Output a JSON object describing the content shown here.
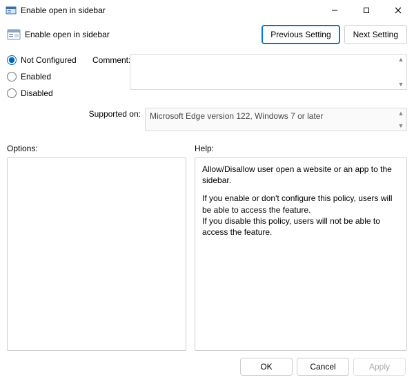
{
  "window": {
    "title": "Enable open in sidebar"
  },
  "header": {
    "title": "Enable open in sidebar",
    "previous": "Previous Setting",
    "next": "Next Setting"
  },
  "state": {
    "not_configured": "Not Configured",
    "enabled": "Enabled",
    "disabled": "Disabled",
    "selected": "not_configured"
  },
  "comment": {
    "label": "Comment:",
    "value": ""
  },
  "supported": {
    "label": "Supported on:",
    "value": "Microsoft Edge version 122, Windows 7 or later"
  },
  "panels": {
    "options_label": "Options:",
    "help_label": "Help:"
  },
  "help": {
    "p1": "Allow/Disallow user open a website or an app to the sidebar.",
    "p2": "If you enable or don't configure this policy, users will be able to access the feature.",
    "p3": "If you disable this policy, users will not be able to access the feature."
  },
  "footer": {
    "ok": "OK",
    "cancel": "Cancel",
    "apply": "Apply"
  }
}
